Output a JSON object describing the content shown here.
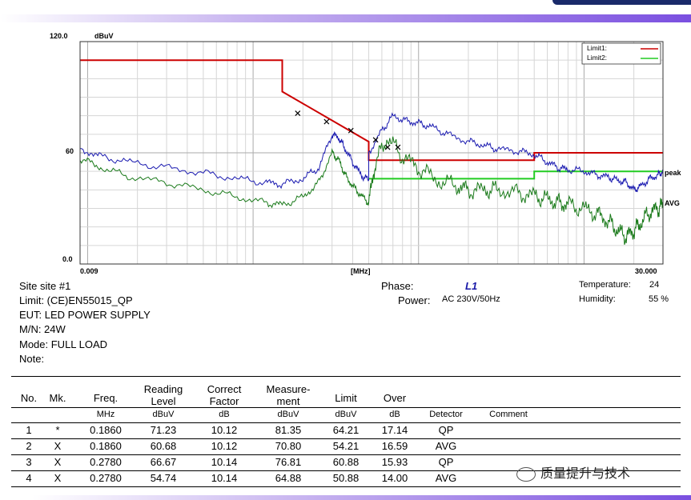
{
  "chart_data": {
    "type": "line",
    "unit_label": "dBuV",
    "x_axis_label": "[MHz]",
    "x_scale": "log",
    "xlim": [
      0.009,
      30.0
    ],
    "ylim": [
      0.0,
      120.0
    ],
    "x_tick_labels": [
      "0.009",
      "30.000"
    ],
    "y_tick_labels": [
      "120.0",
      "60",
      "0.0"
    ],
    "grid": true,
    "legend_placement": "top-right",
    "legend": [
      {
        "name": "Limit1:",
        "color": "#cc0000"
      },
      {
        "name": "Limit2:",
        "color": "#22cc22"
      }
    ],
    "trace_labels": {
      "peak": "peak",
      "avg": "AVG"
    },
    "series": [
      {
        "key": "limit1",
        "color": "#cc0000",
        "x": [
          0.009,
          0.15,
          0.15,
          0.5,
          0.5,
          5.0,
          5.0,
          30.0
        ],
        "y": [
          110,
          110,
          93,
          66,
          56,
          56,
          60,
          60
        ]
      },
      {
        "key": "limit2",
        "color": "#22cc22",
        "x": [
          0.5,
          5.0,
          5.0,
          30.0
        ],
        "y": [
          46,
          46,
          50,
          50
        ]
      },
      {
        "key": "peak",
        "color": "#1a1ab0",
        "x": [
          0.009,
          0.012,
          0.018,
          0.03,
          0.05,
          0.08,
          0.12,
          0.15,
          0.2,
          0.25,
          0.3,
          0.33,
          0.36,
          0.4,
          0.45,
          0.5,
          0.5,
          0.6,
          0.7,
          0.85,
          1.0,
          1.2,
          1.5,
          2.0,
          2.5,
          3.0,
          4.0,
          5.0,
          6.0,
          7.0,
          8.0,
          10.0,
          12.0,
          14.0,
          16.0,
          18.0,
          20.0,
          22.0,
          25.0,
          28.0,
          30.0
        ],
        "y": [
          62,
          58,
          55,
          52,
          49,
          46,
          44,
          43,
          46,
          52,
          70,
          68,
          62,
          55,
          48,
          45,
          60,
          72,
          80,
          77,
          76,
          74,
          70,
          66,
          64,
          62,
          61,
          59,
          55,
          52,
          51,
          50,
          48,
          47,
          45,
          44,
          40,
          42,
          46,
          48,
          50
        ]
      },
      {
        "key": "avg",
        "color": "#1a7a1a",
        "x": [
          0.009,
          0.012,
          0.018,
          0.03,
          0.05,
          0.08,
          0.12,
          0.15,
          0.2,
          0.25,
          0.3,
          0.33,
          0.36,
          0.4,
          0.45,
          0.5,
          0.55,
          0.65,
          0.8,
          1.0,
          1.3,
          1.7,
          2.0,
          2.5,
          3.0,
          4.0,
          5.0,
          6.0,
          7.0,
          8.0,
          10.0,
          12.0,
          14.0,
          16.0,
          18.0,
          20.0,
          22.0,
          25.0,
          28.0,
          30.0
        ],
        "y": [
          57,
          52,
          47,
          44,
          40,
          36,
          33,
          32,
          36,
          44,
          60,
          56,
          48,
          42,
          37,
          33,
          55,
          68,
          58,
          52,
          45,
          42,
          40,
          40,
          40,
          38,
          37,
          35,
          33,
          32,
          30,
          27,
          23,
          18,
          15,
          18,
          22,
          28,
          30,
          32
        ]
      }
    ],
    "markers": [
      {
        "x": 0.186,
        "y": 81.35
      },
      {
        "x": 0.278,
        "y": 76.81
      },
      {
        "x": 0.39,
        "y": 72
      },
      {
        "x": 0.55,
        "y": 67
      },
      {
        "x": 0.65,
        "y": 63
      },
      {
        "x": 0.75,
        "y": 63
      }
    ]
  },
  "info": {
    "site": "Site  site #1",
    "limit": "Limit:  (CE)EN55015_QP",
    "eut": "EUT:  LED POWER SUPPLY",
    "mn": "M/N:  24W",
    "mode": "Mode:   FULL LOAD",
    "note": "Note:",
    "phase_label": "Phase:",
    "phase_value": "L1",
    "power_label": "Power:",
    "power_value": "AC 230V/50Hz",
    "temperature_label": "Temperature:",
    "temperature_value": "24",
    "humidity_label": "Humidity:",
    "humidity_value": "55 %"
  },
  "table": {
    "headers": [
      "No.",
      "Mk.",
      "Freq.",
      "Reading\nLevel",
      "Correct\nFactor",
      "Measure-\nment",
      "Limit",
      "Over"
    ],
    "units": [
      "",
      "",
      "MHz",
      "dBuV",
      "dB",
      "dBuV",
      "dBuV",
      "dB",
      "Detector",
      "Comment"
    ],
    "rows": [
      [
        "1",
        "*",
        "0.1860",
        "71.23",
        "10.12",
        "81.35",
        "64.21",
        "17.14",
        "QP",
        ""
      ],
      [
        "2",
        "X",
        "0.1860",
        "60.68",
        "10.12",
        "70.80",
        "54.21",
        "16.59",
        "AVG",
        ""
      ],
      [
        "3",
        "X",
        "0.2780",
        "66.67",
        "10.14",
        "76.81",
        "60.88",
        "15.93",
        "QP",
        ""
      ],
      [
        "4",
        "X",
        "0.2780",
        "54.74",
        "10.14",
        "64.88",
        "50.88",
        "14.00",
        "AVG",
        ""
      ]
    ]
  },
  "watermark": "质量提升与技术"
}
